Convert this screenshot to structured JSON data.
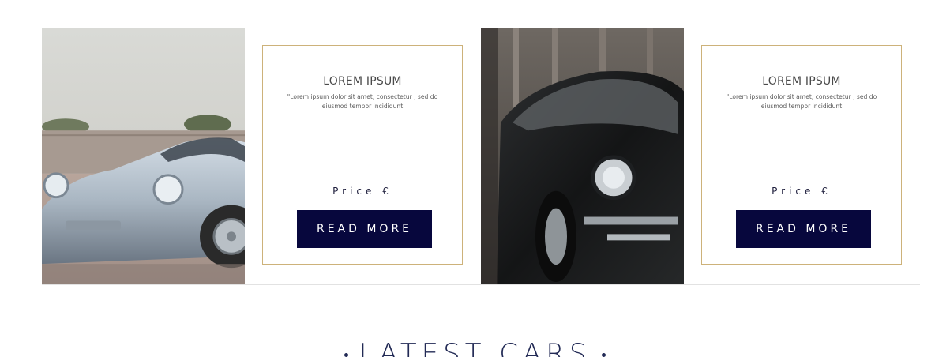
{
  "cards": [
    {
      "title": "LOREM IPSUM",
      "description": "\"Lorem ipsum dolor sit amet, consectetur , sed do eiusmod tempor incididunt",
      "price": "Price €",
      "button_label": "READ MORE"
    },
    {
      "title": "LOREM IPSUM",
      "description": "\"Lorem ipsum dolor sit amet, consectetur , sed do eiusmod tempor incididunt",
      "price": "Price €",
      "button_label": "READ MORE"
    }
  ],
  "section": {
    "heading": "LATEST CARS"
  },
  "colors": {
    "button_bg": "#07073d",
    "card_border": "#cdb27a",
    "heading": "#222a55"
  }
}
